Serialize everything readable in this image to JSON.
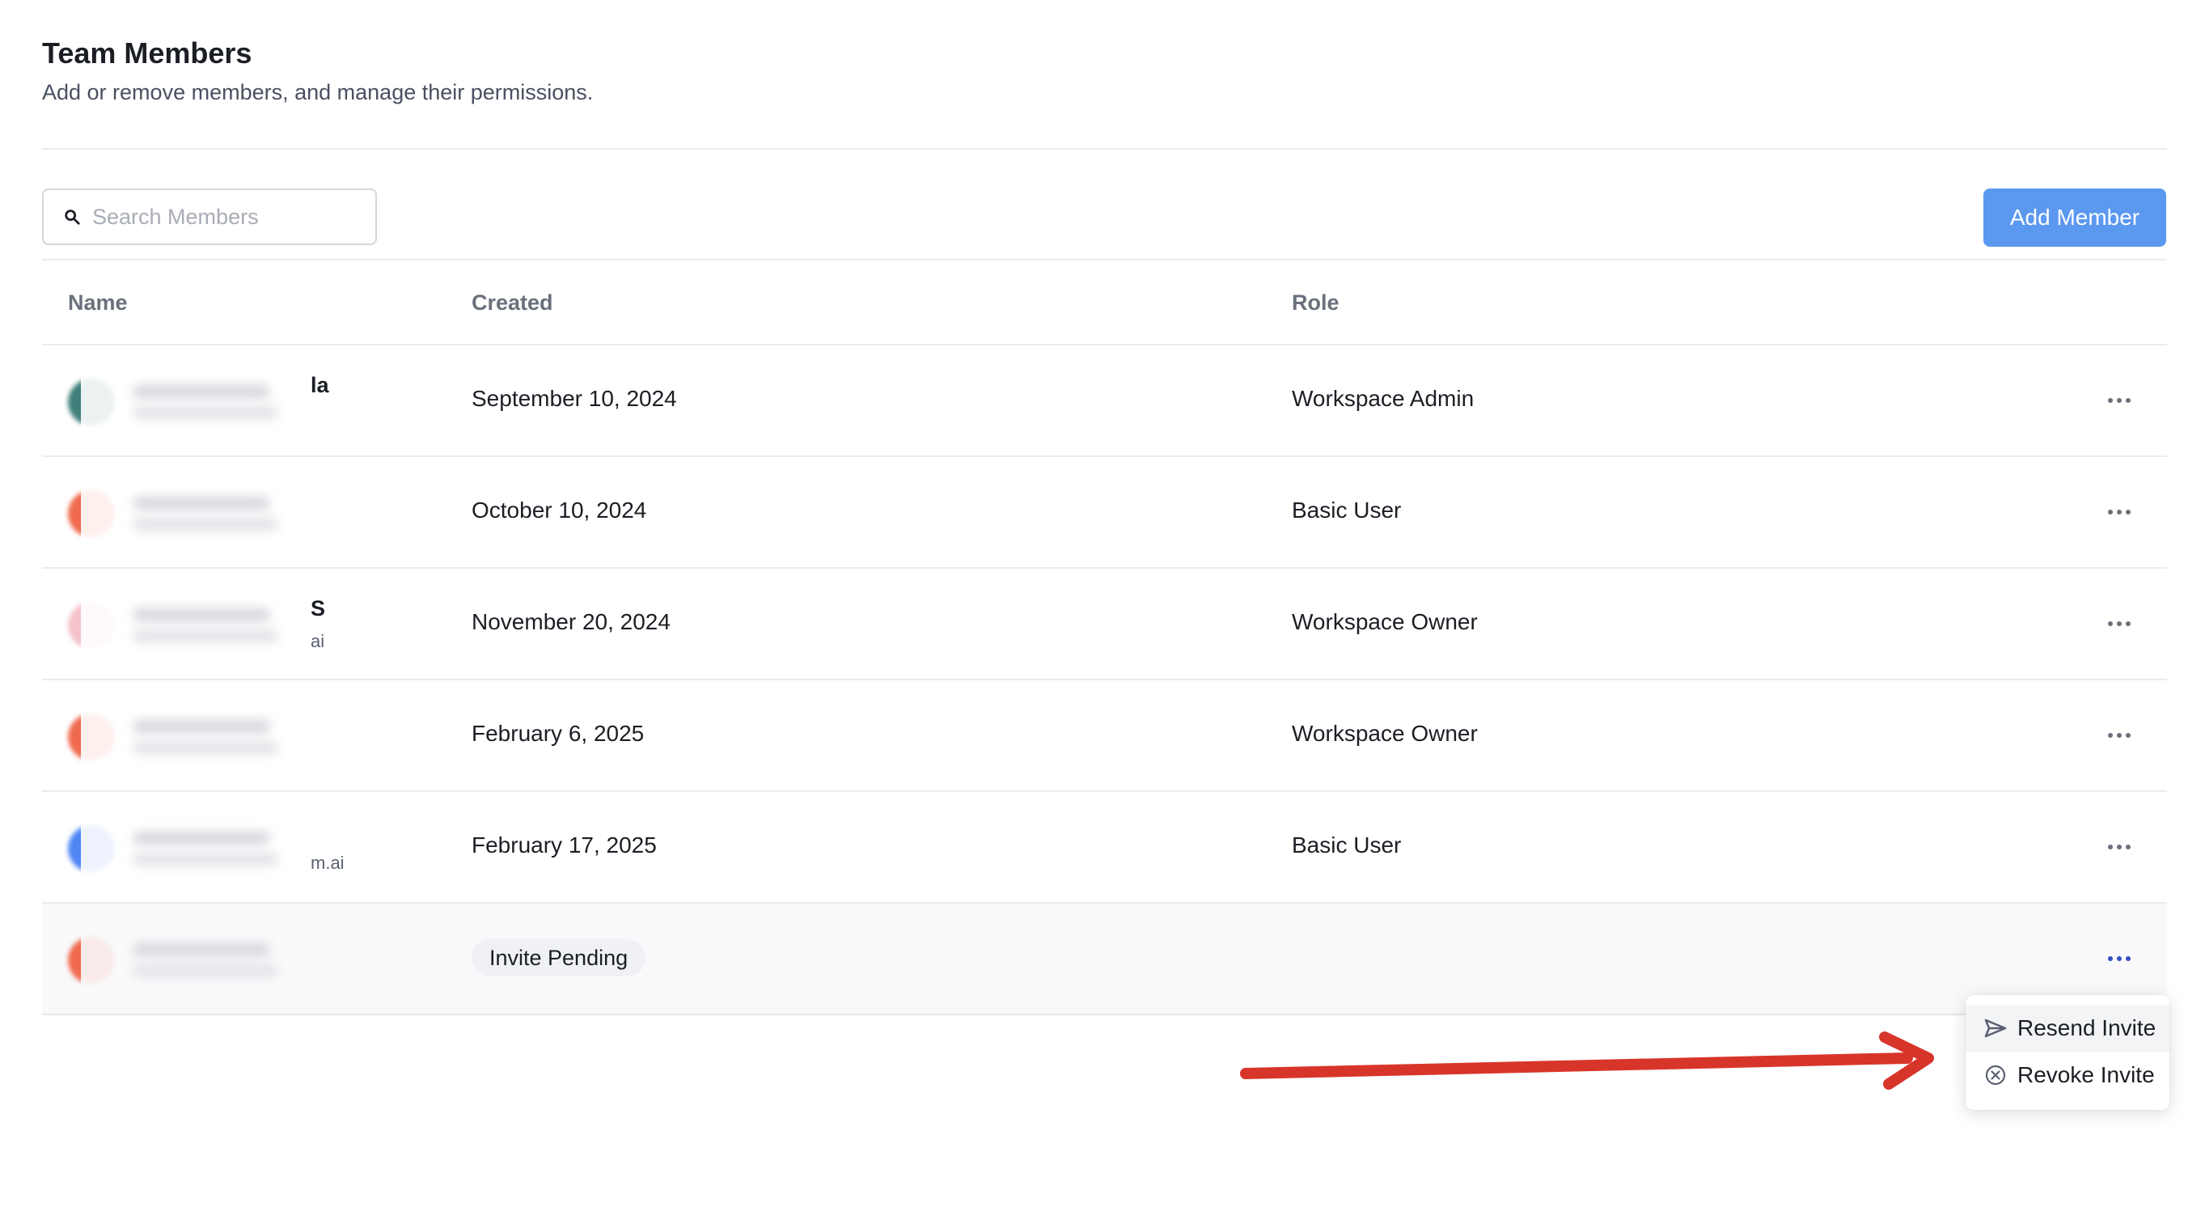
{
  "header": {
    "title": "Team Members",
    "subtitle": "Add or remove members, and manage their permissions."
  },
  "search": {
    "placeholder": "Search Members",
    "icon": "search-icon"
  },
  "add_member_label": "Add Member",
  "table": {
    "columns": [
      "Name",
      "Created",
      "Role"
    ],
    "rows": [
      {
        "name_fragment": "la",
        "email_fragment": "",
        "avatar_color": "#3f7f7a",
        "created": "September 10, 2024",
        "role": "Workspace Admin"
      },
      {
        "name_fragment": "",
        "email_fragment": "",
        "avatar_color": "#ef6a4e",
        "created": "October 10, 2024",
        "role": "Basic User"
      },
      {
        "name_fragment": "S",
        "email_fragment": "ai",
        "avatar_color": "#f5c2ca",
        "created": "November 20, 2024",
        "role": "Workspace Owner"
      },
      {
        "name_fragment": "",
        "email_fragment": "",
        "avatar_color": "#ef6a4e",
        "created": "February 6, 2025",
        "role": "Workspace Owner"
      },
      {
        "name_fragment": "",
        "email_fragment": "m.ai",
        "avatar_color": "#4f86f3",
        "created": "February 17, 2025",
        "role": "Basic User"
      },
      {
        "name_fragment": "",
        "email_fragment": "",
        "avatar_color": "#ef6a4e",
        "status": "Invite Pending",
        "role": ""
      }
    ]
  },
  "menu": {
    "items": [
      {
        "label": "Resend Invite",
        "icon": "send-icon"
      },
      {
        "label": "Revoke Invite",
        "icon": "circle-x-icon"
      }
    ]
  },
  "colors": {
    "accent": "#5b98f0",
    "annotation_arrow": "#d8352a"
  }
}
